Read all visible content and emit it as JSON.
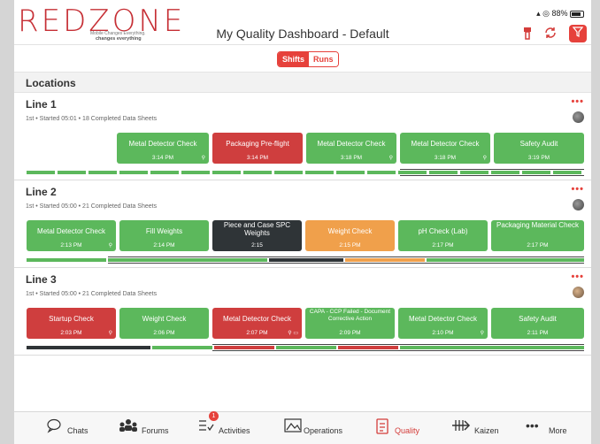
{
  "status": {
    "icons": "▴ ◎",
    "battery": "88%"
  },
  "logo": {
    "word": "REDZONE",
    "tagline1": "Mobile Changes Everything.",
    "tagline2": "changes everything"
  },
  "header": {
    "title": "My Quality Dashboard - Default"
  },
  "segments": [
    {
      "label": "Shifts",
      "active": true
    },
    {
      "label": "Runs",
      "active": false
    }
  ],
  "locations_label": "Locations",
  "lines": [
    {
      "title": "Line 1",
      "subtitle": "1st • Started 05:01 • 18 Completed Data Sheets",
      "cards": [
        {
          "name": "Metal Detector Check",
          "time": "3:14 PM",
          "color": "green"
        },
        {
          "name": "Packaging Pre-flight",
          "time": "3:14 PM",
          "color": "red"
        },
        {
          "name": "Metal Detector Check",
          "time": "3:18 PM",
          "color": "green"
        },
        {
          "name": "Metal Detector Check",
          "time": "3:18 PM",
          "color": "green"
        },
        {
          "name": "Safety Audit",
          "time": "3:19 PM",
          "color": "green"
        }
      ]
    },
    {
      "title": "Line 2",
      "subtitle": "1st • Started 05:00 • 21 Completed Data Sheets",
      "cards": [
        {
          "name": "Metal Detector Check",
          "time": "2:13 PM",
          "color": "green"
        },
        {
          "name": "Fill Weights",
          "time": "2:14 PM",
          "color": "green"
        },
        {
          "name": "Piece and Case SPC Weights",
          "time": "2:15",
          "color": "dark"
        },
        {
          "name": "Weight Check",
          "time": "2:15 PM",
          "color": "orange"
        },
        {
          "name": "pH Check (Lab)",
          "time": "2:17 PM",
          "color": "green"
        },
        {
          "name": "Packaging Material Check",
          "time": "2:17 PM",
          "color": "green"
        }
      ]
    },
    {
      "title": "Line 3",
      "subtitle": "1st • Started 05:00 • 21 Completed Data Sheets",
      "cards": [
        {
          "name": "Startup Check",
          "time": "2:03 PM",
          "color": "red"
        },
        {
          "name": "Weight Check",
          "time": "2:06 PM",
          "color": "green"
        },
        {
          "name": "Metal Detector Check",
          "time": "2:07 PM",
          "color": "red"
        },
        {
          "name": "CAPA - CCP Failed - Document Corrective Action",
          "time": "2:09 PM",
          "color": "green"
        },
        {
          "name": "Metal Detector Check",
          "time": "2:10 PM",
          "color": "green"
        },
        {
          "name": "Safety Audit",
          "time": "2:11 PM",
          "color": "green"
        }
      ]
    }
  ],
  "tabs": [
    {
      "label": "Chats",
      "icon": "chat-icon"
    },
    {
      "label": "Forums",
      "icon": "forums-icon"
    },
    {
      "label": "Activities",
      "icon": "activities-icon",
      "badge": "1"
    },
    {
      "label": "Operations",
      "icon": "operations-icon"
    },
    {
      "label": "Quality",
      "icon": "quality-icon",
      "active": true
    },
    {
      "label": "Kaizen",
      "icon": "kaizen-icon"
    },
    {
      "label": "More",
      "icon": "more-icon"
    }
  ],
  "colors": {
    "accent": "#e6413b",
    "green": "#5cb85c",
    "red": "#cf3e3e",
    "dark": "#2f3437",
    "orange": "#f0a04b"
  }
}
